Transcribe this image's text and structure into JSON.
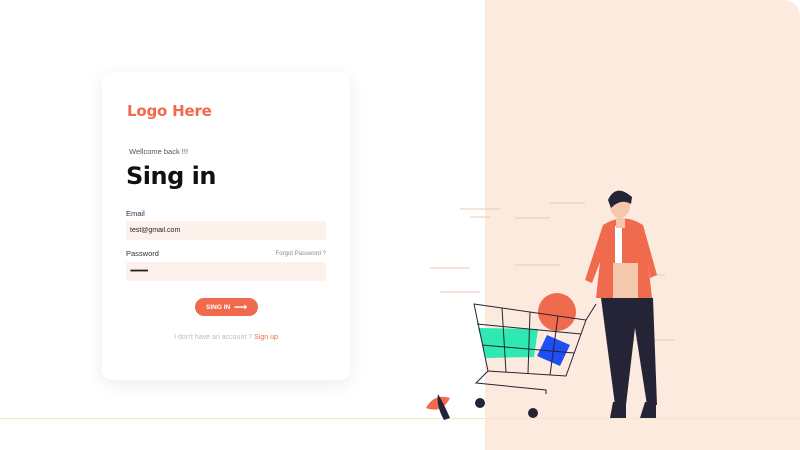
{
  "logo": {
    "text": "Logo Here"
  },
  "form": {
    "welcome": "Wellcome back !!!",
    "title": "Sing in",
    "email_label": "Email",
    "email_value": "test@gmail.com",
    "password_label": "Password",
    "password_value": "••••••••••••",
    "forgot_link": "Forgot Password ?",
    "submit_label": "SING IN",
    "submit_icon": "arrow-right-icon",
    "no_account_text": "I don't have an account ?",
    "signup_link": "Sign up"
  },
  "colors": {
    "accent": "#f06a4d",
    "panel_bg": "#fdeadf",
    "input_bg": "#fdf1ec",
    "cart_green": "#2ee9b2",
    "cart_blue": "#1f4ef2",
    "person_shirt": "#f06a4d",
    "person_pants": "#252437"
  },
  "illustration": {
    "name": "shopping-cart-person-illustration"
  }
}
